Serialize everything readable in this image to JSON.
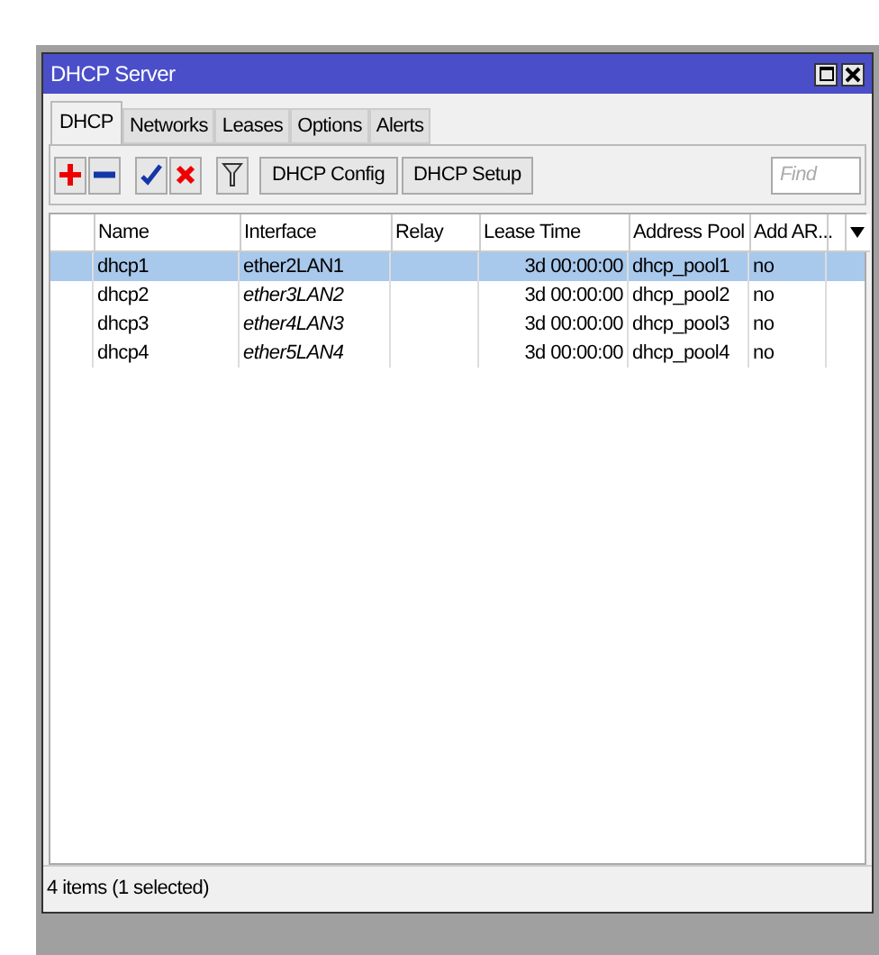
{
  "window": {
    "title": "DHCP Server"
  },
  "tabs": [
    {
      "label": "DHCP",
      "selected": true
    },
    {
      "label": "Networks",
      "selected": false
    },
    {
      "label": "Leases",
      "selected": false
    },
    {
      "label": "Options",
      "selected": false
    },
    {
      "label": "Alerts",
      "selected": false
    }
  ],
  "toolbar": {
    "buttons": [
      "DHCP Config",
      "DHCP Setup"
    ],
    "search": {
      "placeholder": "Find"
    }
  },
  "table": {
    "columns": [
      "Name",
      "Interface",
      "Relay",
      "Lease Time",
      "Address Pool",
      "Add AR..."
    ],
    "rows": [
      {
        "name": "dhcp1",
        "interface": "ether2LAN1",
        "interface_italic": false,
        "lease_time": "3d 00:00:00",
        "address_pool": "dhcp_pool1",
        "add_arp": "no",
        "selected": true
      },
      {
        "name": "dhcp2",
        "interface": "ether3LAN2",
        "interface_italic": true,
        "lease_time": "3d 00:00:00",
        "address_pool": "dhcp_pool2",
        "add_arp": "no",
        "selected": false
      },
      {
        "name": "dhcp3",
        "interface": "ether4LAN3",
        "interface_italic": true,
        "lease_time": "3d 00:00:00",
        "address_pool": "dhcp_pool3",
        "add_arp": "no",
        "selected": false
      },
      {
        "name": "dhcp4",
        "interface": "ether5LAN4",
        "interface_italic": true,
        "lease_time": "3d 00:00:00",
        "address_pool": "dhcp_pool4",
        "add_arp": "no",
        "selected": false
      }
    ]
  },
  "status_bar": "4 items (1 selected)"
}
